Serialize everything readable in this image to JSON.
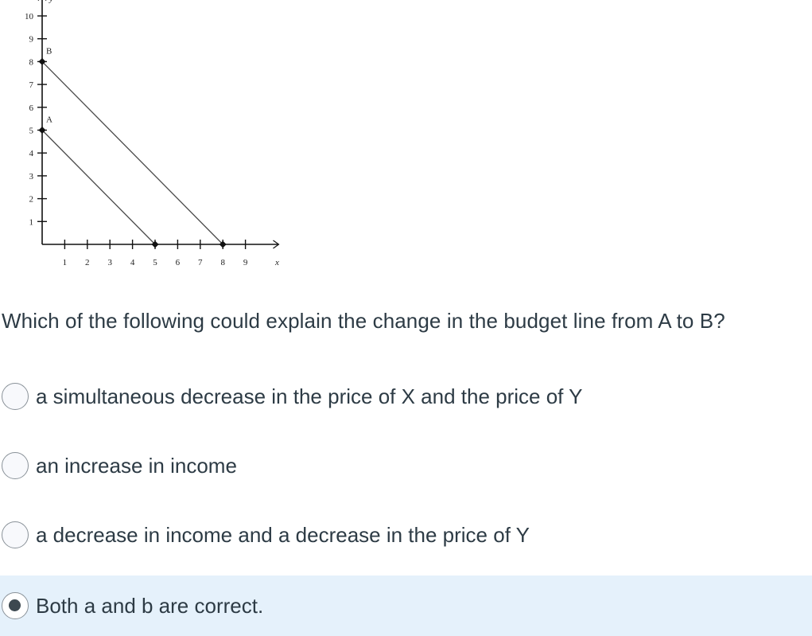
{
  "chart_data": {
    "type": "line",
    "title": "",
    "xlabel": "x",
    "ylabel": "y",
    "xlim": [
      0,
      9.7
    ],
    "ylim": [
      0,
      10.5
    ],
    "x_ticks": [
      1,
      2,
      3,
      4,
      5,
      6,
      7,
      8,
      9
    ],
    "y_ticks": [
      1,
      2,
      3,
      4,
      5,
      6,
      7,
      8,
      9,
      10
    ],
    "grid": false,
    "series": [
      {
        "name": "A",
        "points": [
          [
            0,
            5
          ],
          [
            5,
            0
          ]
        ],
        "label": "A"
      },
      {
        "name": "B",
        "points": [
          [
            0,
            8
          ],
          [
            8,
            0
          ]
        ],
        "label": "B"
      }
    ],
    "markers": [
      [
        0,
        5
      ],
      [
        5,
        0
      ],
      [
        0,
        8
      ],
      [
        8,
        0
      ]
    ],
    "colors": {
      "axis": "#111111",
      "line": "#4a4a4a",
      "marker": "#111111"
    }
  },
  "question": {
    "text": "Which of the following could explain the change in the budget line from A to B?"
  },
  "answers": [
    {
      "label": "a simultaneous decrease in the price of X and the price of Y",
      "selected": false
    },
    {
      "label": "an increase in income",
      "selected": false
    },
    {
      "label": "a decrease in income and a decrease in the price of Y",
      "selected": false
    },
    {
      "label": "Both a and b are correct.",
      "selected": true
    }
  ],
  "colors": {
    "selected_bg": "#e5f1fb",
    "text": "#2d3b45"
  }
}
